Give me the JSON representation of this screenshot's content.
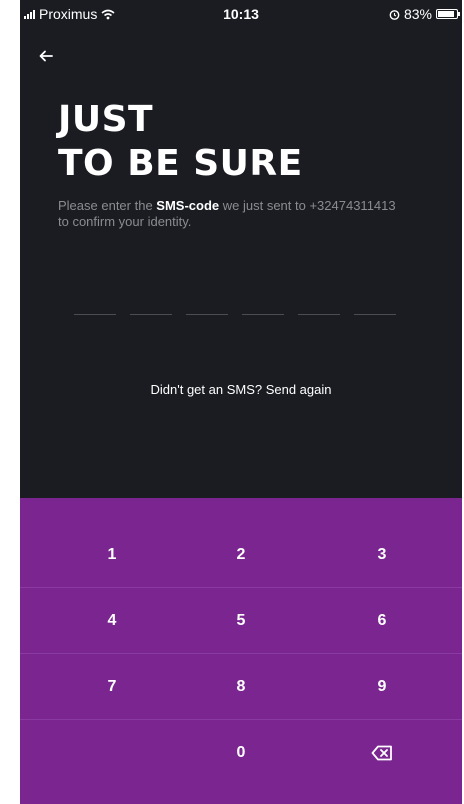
{
  "status_bar": {
    "carrier": "Proximus",
    "time": "10:13",
    "battery": "83%",
    "icons": [
      "signal-icon",
      "wifi-icon",
      "alarm-icon",
      "battery-icon"
    ]
  },
  "header": {
    "back_icon": "arrow-left-icon",
    "title_line1": "JUST",
    "title_line2": "TO BE SURE"
  },
  "message": {
    "prefix": "Please enter the ",
    "highlight": "SMS-code",
    "suffix": " we just sent to +32474311413 to confirm your identity."
  },
  "code_input": {
    "digits": 6,
    "value": ""
  },
  "resend_text": "Didn't get an SMS? Send again",
  "keypad": {
    "rows": [
      [
        "1",
        "2",
        "3"
      ],
      [
        "4",
        "5",
        "6"
      ],
      [
        "7",
        "8",
        "9"
      ],
      [
        "",
        "0",
        "backspace"
      ]
    ],
    "backspace_icon": "backspace-icon"
  },
  "colors": {
    "background": "#1a1c21",
    "keypad_background": "#7a2590",
    "muted_text": "#8a8c92"
  }
}
